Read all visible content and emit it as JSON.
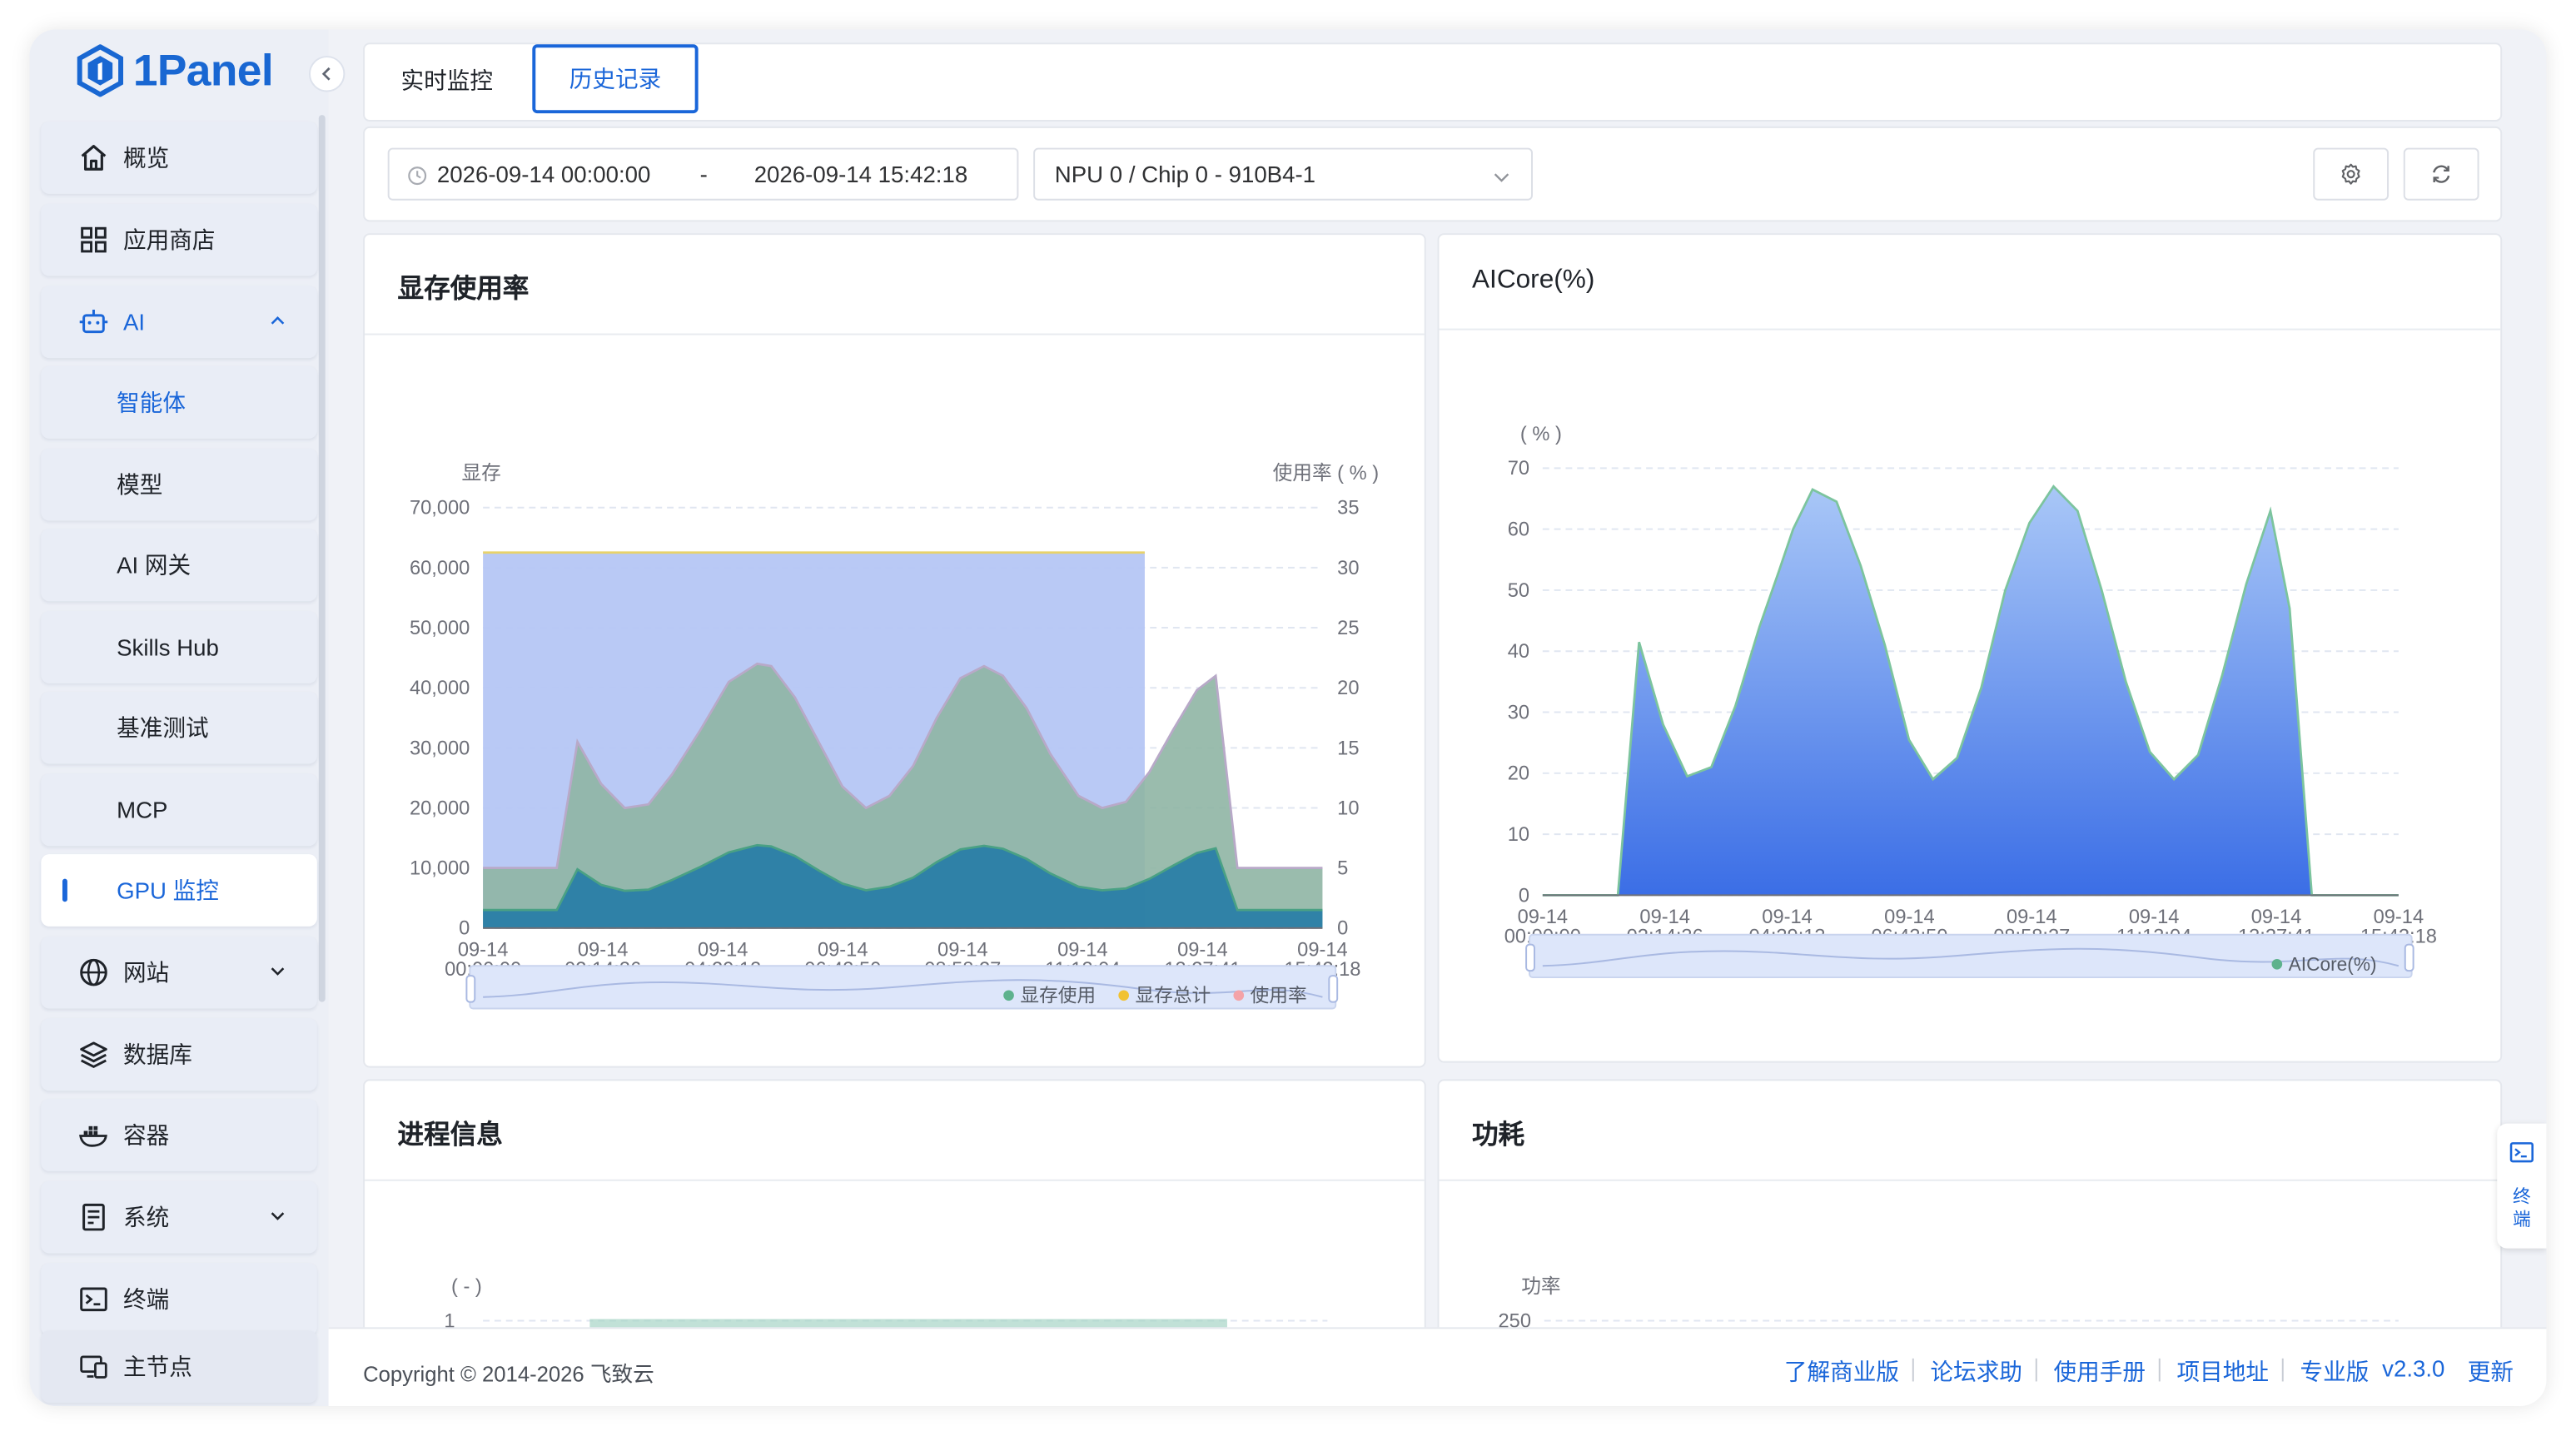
{
  "app": {
    "logo_text": "1Panel"
  },
  "sidebar": {
    "items": [
      {
        "label": "概览",
        "icon": "home-icon"
      },
      {
        "label": "应用商店",
        "icon": "apps-grid-icon"
      },
      {
        "label": "AI",
        "icon": "robot-icon",
        "expanded": true
      },
      {
        "label": "智能体"
      },
      {
        "label": "模型"
      },
      {
        "label": "AI 网关"
      },
      {
        "label": "Skills Hub"
      },
      {
        "label": "基准测试"
      },
      {
        "label": "MCP"
      },
      {
        "label": "GPU 监控",
        "active": true
      },
      {
        "label": "网站",
        "icon": "globe-icon"
      },
      {
        "label": "数据库",
        "icon": "database-layers-icon"
      },
      {
        "label": "容器",
        "icon": "container-whale-icon"
      },
      {
        "label": "系统",
        "icon": "system-server-icon"
      },
      {
        "label": "终端",
        "icon": "terminal-icon"
      },
      {
        "label": "主节点",
        "icon": "node-monitor-icon"
      }
    ]
  },
  "tabs": [
    {
      "label": "实时监控"
    },
    {
      "label": "历史记录",
      "active": true
    }
  ],
  "filters": {
    "date_start": "2026-09-14 00:00:00",
    "date_sep": "-",
    "date_end": "2026-09-14 15:42:18",
    "device": "NPU 0 / Chip 0 - 910B4-1"
  },
  "cards": {
    "memory": {
      "title": "显存使用率"
    },
    "aicore": {
      "title": "AICore(%)"
    },
    "process": {
      "title": "进程信息",
      "axis_unit": "( - )",
      "first_tick": "1"
    },
    "power": {
      "title": "功耗",
      "axis_label": "功率",
      "first_tick": "250"
    }
  },
  "chart_data": [
    {
      "type": "area",
      "name": "memory",
      "x": [
        "09-14 00:00:00",
        "09-14 02:14:36",
        "09-14 04:29:13",
        "09-14 06:43:50",
        "09-14 08:58:27",
        "09-14 11:13:04",
        "09-14 13:27:41",
        "09-14 15:42:18"
      ],
      "ylabel": "显存",
      "y2label": "使用率 ( % )",
      "ylim": [
        0,
        70000
      ],
      "y2lim": [
        0,
        35
      ],
      "yticks": [
        "0",
        "10,000",
        "20,000",
        "30,000",
        "40,000",
        "50,000",
        "60,000",
        "70,000"
      ],
      "y2ticks": [
        "0",
        "5",
        "10",
        "15",
        "20",
        "25",
        "30",
        "35"
      ],
      "legend": [
        "显存使用",
        "显存总计",
        "使用率"
      ],
      "legend_position": "bottom-right",
      "colors": {
        "used": "#2e8aa6",
        "total": "#bccbf4",
        "rate": "#8fb5a4"
      },
      "series": [
        {
          "name": "显存总计",
          "axis": "left",
          "points": [
            [
              0,
              62500
            ],
            [
              1,
              62500
            ],
            [
              2,
              62500
            ],
            [
              3,
              62500
            ],
            [
              4,
              62500
            ],
            [
              5,
              62500
            ],
            [
              6,
              62500
            ],
            [
              7,
              62500
            ]
          ]
        },
        {
          "name": "使用率",
          "axis": "right",
          "points": [
            [
              0,
              5
            ],
            [
              0.55,
              5
            ],
            [
              0.78,
              5
            ],
            [
              1,
              15.5
            ],
            [
              1.25,
              12
            ],
            [
              1.5,
              10
            ],
            [
              1.75,
              10.3
            ],
            [
              2,
              12.8
            ],
            [
              2.3,
              16.5
            ],
            [
              2.6,
              20.5
            ],
            [
              2.9,
              22
            ],
            [
              3.05,
              21.8
            ],
            [
              3.3,
              19.2
            ],
            [
              3.55,
              15.5
            ],
            [
              3.8,
              11.8
            ],
            [
              4.05,
              10
            ],
            [
              4.3,
              11
            ],
            [
              4.55,
              13.5
            ],
            [
              4.8,
              17.5
            ],
            [
              5.05,
              20.8
            ],
            [
              5.3,
              21.8
            ],
            [
              5.5,
              21
            ],
            [
              5.75,
              18.3
            ],
            [
              6,
              14.5
            ],
            [
              6.3,
              11
            ],
            [
              6.55,
              10
            ],
            [
              6.8,
              10.5
            ],
            [
              7.05,
              13
            ],
            [
              7.3,
              16.5
            ],
            [
              7.55,
              19.8
            ],
            [
              7.75,
              21
            ],
            [
              7.98,
              5
            ],
            [
              8.3,
              5
            ],
            [
              8.88,
              5
            ]
          ]
        },
        {
          "name": "显存使用",
          "axis": "left",
          "points": [
            [
              0,
              3000
            ],
            [
              0.55,
              3000
            ],
            [
              0.78,
              3000
            ],
            [
              1,
              9800
            ],
            [
              1.25,
              7200
            ],
            [
              1.5,
              6200
            ],
            [
              1.75,
              6400
            ],
            [
              2,
              8000
            ],
            [
              2.3,
              10200
            ],
            [
              2.6,
              12600
            ],
            [
              2.9,
              13800
            ],
            [
              3.05,
              13600
            ],
            [
              3.3,
              12000
            ],
            [
              3.55,
              9600
            ],
            [
              3.8,
              7400
            ],
            [
              4.05,
              6300
            ],
            [
              4.3,
              6900
            ],
            [
              4.55,
              8400
            ],
            [
              4.8,
              11000
            ],
            [
              5.05,
              13100
            ],
            [
              5.3,
              13700
            ],
            [
              5.5,
              13200
            ],
            [
              5.75,
              11500
            ],
            [
              6,
              9100
            ],
            [
              6.3,
              6900
            ],
            [
              6.55,
              6300
            ],
            [
              6.8,
              6600
            ],
            [
              7.05,
              8200
            ],
            [
              7.3,
              10400
            ],
            [
              7.55,
              12500
            ],
            [
              7.75,
              13300
            ],
            [
              7.98,
              3000
            ],
            [
              8.3,
              3000
            ],
            [
              8.88,
              3000
            ]
          ]
        }
      ]
    },
    {
      "type": "area",
      "name": "aicore",
      "x": [
        "09-14 00:00:00",
        "09-14 02:14:36",
        "09-14 04:29:13",
        "09-14 06:43:50",
        "09-14 08:58:27",
        "09-14 11:13:04",
        "09-14 13:27:41",
        "09-14 15:42:18"
      ],
      "ylabel": "( % )",
      "ylim": [
        0,
        70
      ],
      "yticks": [
        "0",
        "10",
        "20",
        "30",
        "40",
        "50",
        "60",
        "70"
      ],
      "legend": [
        "AICore(%)"
      ],
      "legend_position": "bottom-right",
      "colors": {
        "line": "#7cc49e",
        "fill_top": "#a9c7f7",
        "fill_bottom": "#3b6ee6"
      },
      "series": [
        {
          "name": "AICore(%)",
          "points": [
            [
              0,
              0
            ],
            [
              0.78,
              0
            ],
            [
              1,
              41.5
            ],
            [
              1.25,
              28
            ],
            [
              1.5,
              19.5
            ],
            [
              1.75,
              21
            ],
            [
              2,
              31
            ],
            [
              2.25,
              44
            ],
            [
              2.45,
              53
            ],
            [
              2.6,
              60
            ],
            [
              2.8,
              66.5
            ],
            [
              3.05,
              64.5
            ],
            [
              3.3,
              54
            ],
            [
              3.55,
              41
            ],
            [
              3.8,
              25.5
            ],
            [
              4.05,
              19
            ],
            [
              4.3,
              22.5
            ],
            [
              4.55,
              34
            ],
            [
              4.8,
              50
            ],
            [
              5.05,
              61
            ],
            [
              5.3,
              67
            ],
            [
              5.55,
              63
            ],
            [
              5.8,
              50
            ],
            [
              6.05,
              35
            ],
            [
              6.3,
              23.5
            ],
            [
              6.55,
              19
            ],
            [
              6.8,
              23
            ],
            [
              7.05,
              36
            ],
            [
              7.3,
              51
            ],
            [
              7.55,
              63
            ],
            [
              7.75,
              47
            ],
            [
              7.98,
              0
            ],
            [
              8.3,
              0
            ],
            [
              8.88,
              0
            ]
          ]
        }
      ]
    }
  ]
}
